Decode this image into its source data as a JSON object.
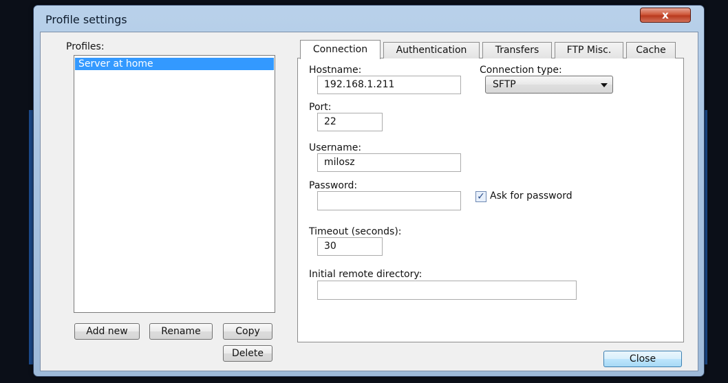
{
  "window": {
    "title": "Profile settings",
    "close_glyph": "x"
  },
  "profiles": {
    "label": "Profiles:",
    "items": [
      "Server at home"
    ],
    "selected_index": 0,
    "buttons": {
      "add_new": "Add new",
      "rename": "Rename",
      "copy": "Copy",
      "delete": "Delete"
    }
  },
  "tabs": [
    {
      "label": "Connection",
      "active": true
    },
    {
      "label": "Authentication",
      "active": false
    },
    {
      "label": "Transfers",
      "active": false
    },
    {
      "label": "FTP Misc.",
      "active": false
    },
    {
      "label": "Cache",
      "active": false
    }
  ],
  "connection": {
    "hostname": {
      "label": "Hostname:",
      "value": "192.168.1.211"
    },
    "connection_type": {
      "label": "Connection type:",
      "value": "SFTP"
    },
    "port": {
      "label": "Port:",
      "value": "22"
    },
    "username": {
      "label": "Username:",
      "value": "milosz"
    },
    "password": {
      "label": "Password:",
      "value": ""
    },
    "ask_for_password": {
      "label": "Ask for password",
      "checked": true,
      "check_glyph": "✓"
    },
    "timeout": {
      "label": "Timeout (seconds):",
      "value": "30"
    },
    "initial_remote_directory": {
      "label": "Initial remote directory:",
      "value": ""
    }
  },
  "footer": {
    "close_label": "Close"
  }
}
